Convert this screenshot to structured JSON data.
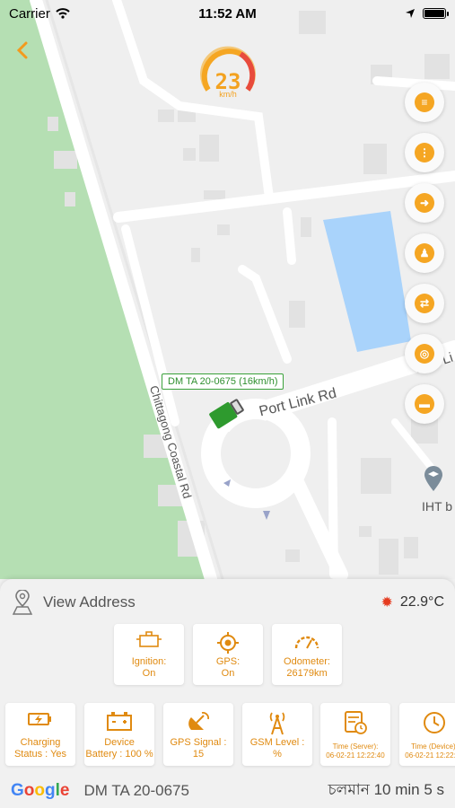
{
  "status_bar": {
    "carrier": "Carrier",
    "time": "11:52 AM"
  },
  "speedometer": {
    "value": "23",
    "unit": "km/h"
  },
  "map": {
    "road_label_1": "Port Link Rd",
    "road_label_2": "Chittagong Coastal Rd",
    "road_label_3": "Port Li",
    "place_label": "IHT b",
    "vehicle_tag": "DM TA 20-0675 (16km/h)"
  },
  "map_controls": [
    "layers-icon",
    "traffic-icon",
    "directions-icon",
    "street-view-icon",
    "swap-icon",
    "my-location-icon",
    "ruler-icon"
  ],
  "panel": {
    "view_address": "View Address",
    "temperature": "22.9°C",
    "row1": [
      {
        "label": "Ignition:",
        "value": "On",
        "icon": "engine-icon"
      },
      {
        "label": "GPS:",
        "value": "On",
        "icon": "gps-icon"
      },
      {
        "label": "Odometer:",
        "value": "26179km",
        "icon": "odometer-icon"
      }
    ],
    "row2": [
      {
        "label": "Charging",
        "value": "Status : Yes",
        "icon": "charging-icon"
      },
      {
        "label": "Device",
        "value": "Battery : 100 %",
        "icon": "battery-icon"
      },
      {
        "label": "GPS Signal :",
        "value": "15",
        "icon": "satellite-icon"
      },
      {
        "label": "GSM Level :",
        "value": "%",
        "icon": "tower-icon"
      },
      {
        "label": "Time (Server):",
        "value": "06-02-21 12:22:40",
        "icon": "server-time-icon"
      },
      {
        "label": "Time (Device):",
        "value": "06-02-21 12:22:40",
        "icon": "device-time-icon"
      }
    ],
    "google": [
      "G",
      "o",
      "o",
      "g",
      "l",
      "e"
    ],
    "plate": "DM TA 20-0675",
    "duration": "চলমান 10 min 5 s"
  },
  "colors": {
    "accent": "#f5a623",
    "vehicle": "#2e9a2e",
    "water": "#a9d3fb",
    "park": "#b5dfb3"
  }
}
